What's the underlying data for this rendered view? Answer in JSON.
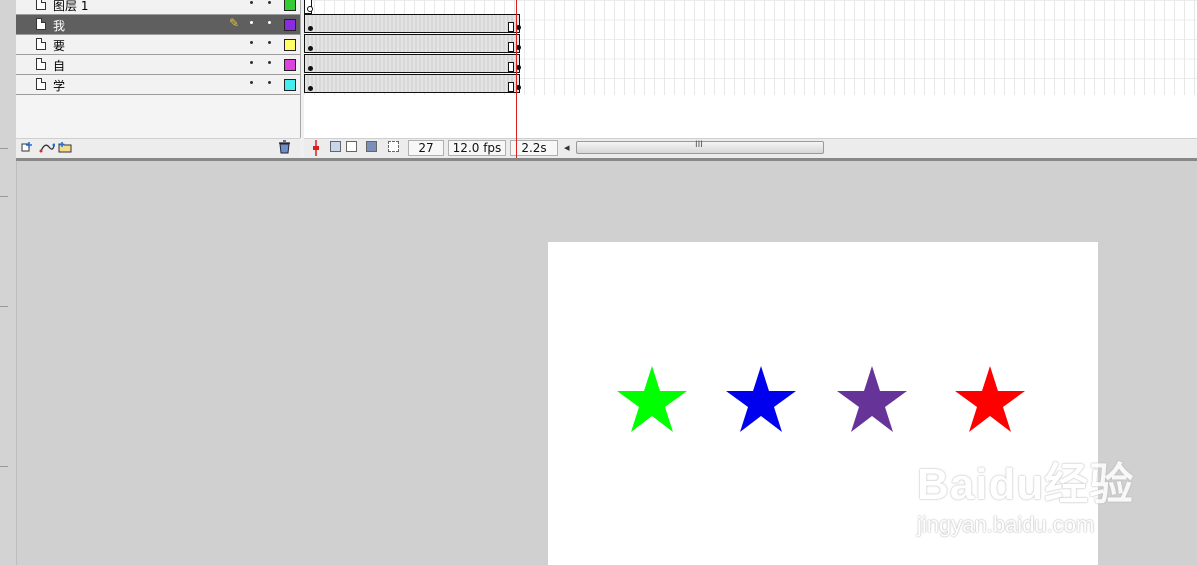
{
  "layers": [
    {
      "name": "图层 1",
      "color": "#33cc33",
      "selected": false
    },
    {
      "name": "我",
      "color": "#8a2be2",
      "selected": true
    },
    {
      "name": "要",
      "color": "#ffff66",
      "selected": false
    },
    {
      "name": "自",
      "color": "#dd44dd",
      "selected": false
    },
    {
      "name": "学",
      "color": "#44eeee",
      "selected": false
    }
  ],
  "timeline": {
    "current_frame": "27",
    "frame_rate": "12.0 fps",
    "elapsed_time": "2.2s",
    "scroll_thumb_glyph": "III",
    "scroll_left_glyph": "◂"
  },
  "stage": {
    "stars": [
      {
        "color": "#00ff00",
        "name": "green"
      },
      {
        "color": "#0000ee",
        "name": "blue"
      },
      {
        "color": "#663399",
        "name": "purple"
      },
      {
        "color": "#ff0000",
        "name": "red"
      }
    ]
  },
  "watermark": {
    "logo_text": "Baidu经验",
    "url_text": "jingyan.baidu.com"
  },
  "icons": {
    "pencil": "✎",
    "trash": "🗑"
  }
}
